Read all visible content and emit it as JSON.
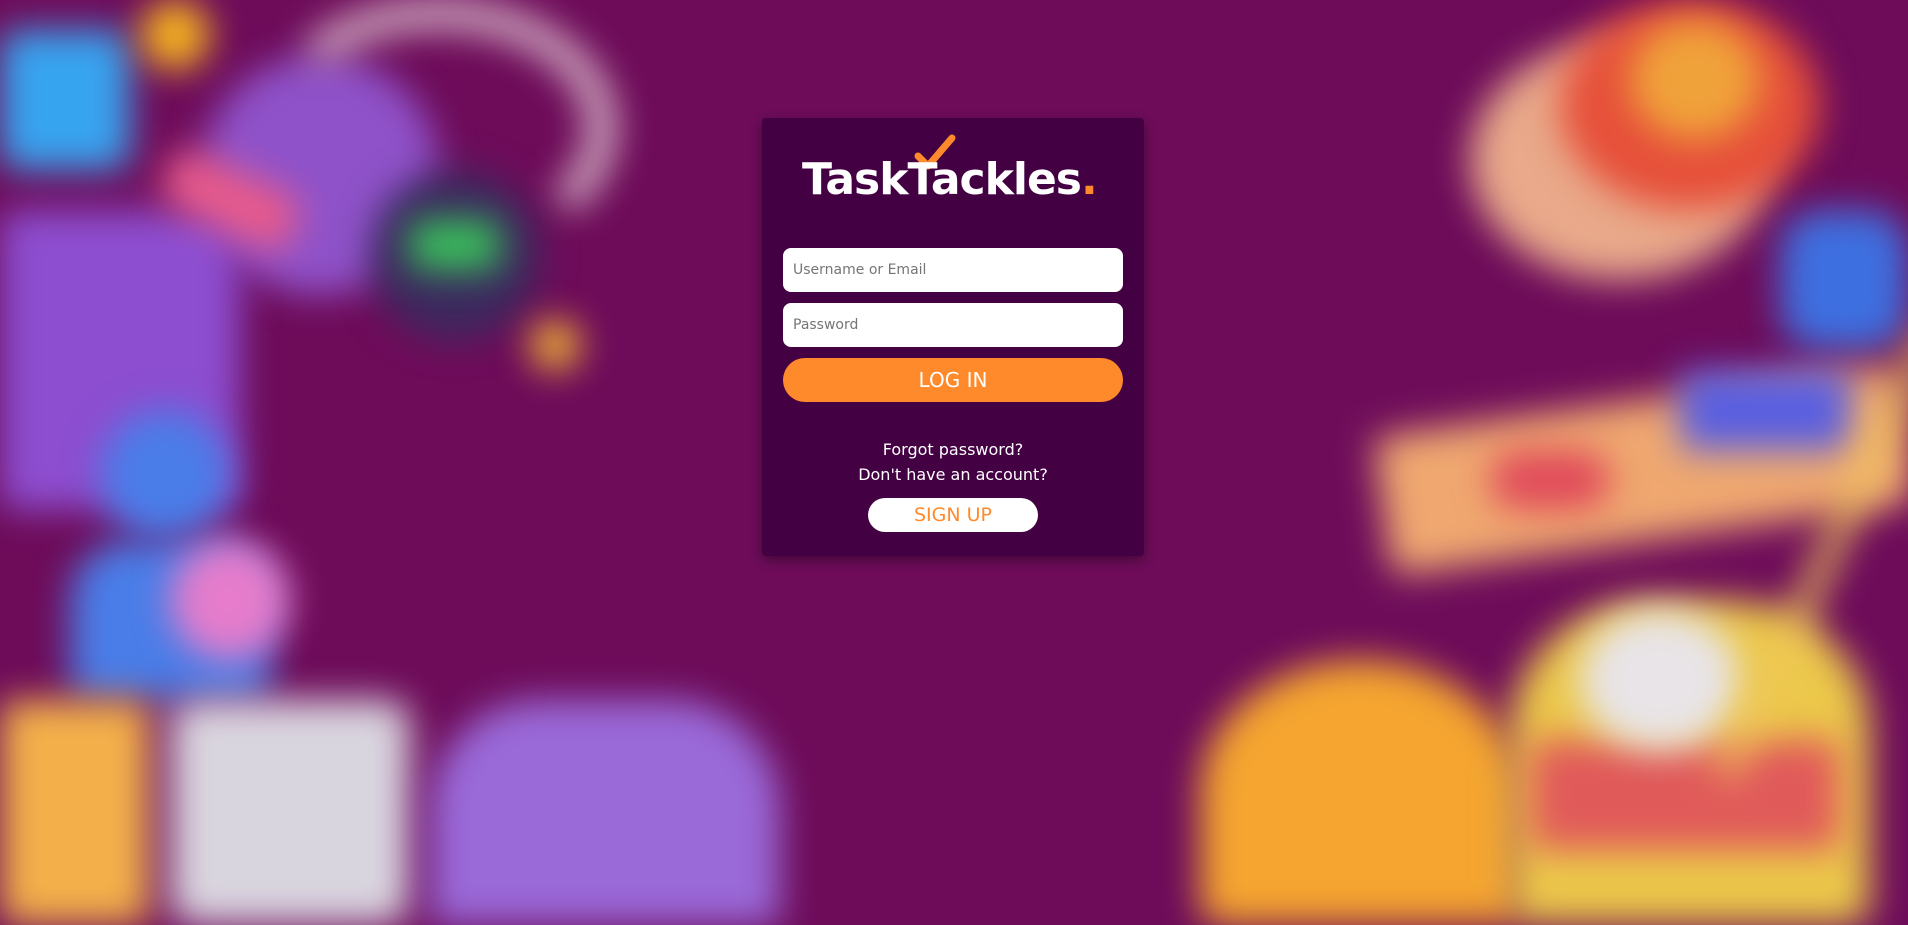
{
  "brand": {
    "name_part1": "Task",
    "name_part2": "ackles",
    "dot": ".",
    "accent_color": "#ff8a2b"
  },
  "form": {
    "username_placeholder": "Username or Email",
    "password_placeholder": "Password",
    "login_label": "LOG IN",
    "forgot_label": "Forgot password?",
    "no_account_text": "Don't have an account?",
    "signup_label": "SIGN UP"
  },
  "colors": {
    "background": "#6e0c5a",
    "card": "#430043",
    "accent": "#ff8a2b"
  }
}
